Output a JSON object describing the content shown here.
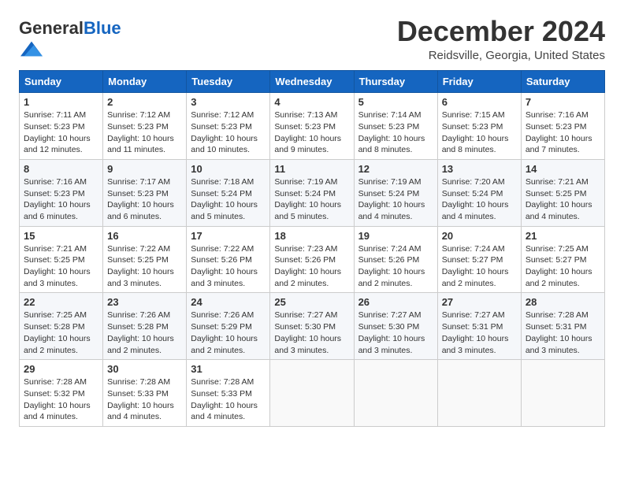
{
  "header": {
    "logo_general": "General",
    "logo_blue": "Blue",
    "month_title": "December 2024",
    "location": "Reidsville, Georgia, United States"
  },
  "weekdays": [
    "Sunday",
    "Monday",
    "Tuesday",
    "Wednesday",
    "Thursday",
    "Friday",
    "Saturday"
  ],
  "weeks": [
    [
      {
        "day": "1",
        "lines": [
          "Sunrise: 7:11 AM",
          "Sunset: 5:23 PM",
          "Daylight: 10 hours",
          "and 12 minutes."
        ]
      },
      {
        "day": "2",
        "lines": [
          "Sunrise: 7:12 AM",
          "Sunset: 5:23 PM",
          "Daylight: 10 hours",
          "and 11 minutes."
        ]
      },
      {
        "day": "3",
        "lines": [
          "Sunrise: 7:12 AM",
          "Sunset: 5:23 PM",
          "Daylight: 10 hours",
          "and 10 minutes."
        ]
      },
      {
        "day": "4",
        "lines": [
          "Sunrise: 7:13 AM",
          "Sunset: 5:23 PM",
          "Daylight: 10 hours",
          "and 9 minutes."
        ]
      },
      {
        "day": "5",
        "lines": [
          "Sunrise: 7:14 AM",
          "Sunset: 5:23 PM",
          "Daylight: 10 hours",
          "and 8 minutes."
        ]
      },
      {
        "day": "6",
        "lines": [
          "Sunrise: 7:15 AM",
          "Sunset: 5:23 PM",
          "Daylight: 10 hours",
          "and 8 minutes."
        ]
      },
      {
        "day": "7",
        "lines": [
          "Sunrise: 7:16 AM",
          "Sunset: 5:23 PM",
          "Daylight: 10 hours",
          "and 7 minutes."
        ]
      }
    ],
    [
      {
        "day": "8",
        "lines": [
          "Sunrise: 7:16 AM",
          "Sunset: 5:23 PM",
          "Daylight: 10 hours",
          "and 6 minutes."
        ]
      },
      {
        "day": "9",
        "lines": [
          "Sunrise: 7:17 AM",
          "Sunset: 5:23 PM",
          "Daylight: 10 hours",
          "and 6 minutes."
        ]
      },
      {
        "day": "10",
        "lines": [
          "Sunrise: 7:18 AM",
          "Sunset: 5:24 PM",
          "Daylight: 10 hours",
          "and 5 minutes."
        ]
      },
      {
        "day": "11",
        "lines": [
          "Sunrise: 7:19 AM",
          "Sunset: 5:24 PM",
          "Daylight: 10 hours",
          "and 5 minutes."
        ]
      },
      {
        "day": "12",
        "lines": [
          "Sunrise: 7:19 AM",
          "Sunset: 5:24 PM",
          "Daylight: 10 hours",
          "and 4 minutes."
        ]
      },
      {
        "day": "13",
        "lines": [
          "Sunrise: 7:20 AM",
          "Sunset: 5:24 PM",
          "Daylight: 10 hours",
          "and 4 minutes."
        ]
      },
      {
        "day": "14",
        "lines": [
          "Sunrise: 7:21 AM",
          "Sunset: 5:25 PM",
          "Daylight: 10 hours",
          "and 4 minutes."
        ]
      }
    ],
    [
      {
        "day": "15",
        "lines": [
          "Sunrise: 7:21 AM",
          "Sunset: 5:25 PM",
          "Daylight: 10 hours",
          "and 3 minutes."
        ]
      },
      {
        "day": "16",
        "lines": [
          "Sunrise: 7:22 AM",
          "Sunset: 5:25 PM",
          "Daylight: 10 hours",
          "and 3 minutes."
        ]
      },
      {
        "day": "17",
        "lines": [
          "Sunrise: 7:22 AM",
          "Sunset: 5:26 PM",
          "Daylight: 10 hours",
          "and 3 minutes."
        ]
      },
      {
        "day": "18",
        "lines": [
          "Sunrise: 7:23 AM",
          "Sunset: 5:26 PM",
          "Daylight: 10 hours",
          "and 2 minutes."
        ]
      },
      {
        "day": "19",
        "lines": [
          "Sunrise: 7:24 AM",
          "Sunset: 5:26 PM",
          "Daylight: 10 hours",
          "and 2 minutes."
        ]
      },
      {
        "day": "20",
        "lines": [
          "Sunrise: 7:24 AM",
          "Sunset: 5:27 PM",
          "Daylight: 10 hours",
          "and 2 minutes."
        ]
      },
      {
        "day": "21",
        "lines": [
          "Sunrise: 7:25 AM",
          "Sunset: 5:27 PM",
          "Daylight: 10 hours",
          "and 2 minutes."
        ]
      }
    ],
    [
      {
        "day": "22",
        "lines": [
          "Sunrise: 7:25 AM",
          "Sunset: 5:28 PM",
          "Daylight: 10 hours",
          "and 2 minutes."
        ]
      },
      {
        "day": "23",
        "lines": [
          "Sunrise: 7:26 AM",
          "Sunset: 5:28 PM",
          "Daylight: 10 hours",
          "and 2 minutes."
        ]
      },
      {
        "day": "24",
        "lines": [
          "Sunrise: 7:26 AM",
          "Sunset: 5:29 PM",
          "Daylight: 10 hours",
          "and 2 minutes."
        ]
      },
      {
        "day": "25",
        "lines": [
          "Sunrise: 7:27 AM",
          "Sunset: 5:30 PM",
          "Daylight: 10 hours",
          "and 3 minutes."
        ]
      },
      {
        "day": "26",
        "lines": [
          "Sunrise: 7:27 AM",
          "Sunset: 5:30 PM",
          "Daylight: 10 hours",
          "and 3 minutes."
        ]
      },
      {
        "day": "27",
        "lines": [
          "Sunrise: 7:27 AM",
          "Sunset: 5:31 PM",
          "Daylight: 10 hours",
          "and 3 minutes."
        ]
      },
      {
        "day": "28",
        "lines": [
          "Sunrise: 7:28 AM",
          "Sunset: 5:31 PM",
          "Daylight: 10 hours",
          "and 3 minutes."
        ]
      }
    ],
    [
      {
        "day": "29",
        "lines": [
          "Sunrise: 7:28 AM",
          "Sunset: 5:32 PM",
          "Daylight: 10 hours",
          "and 4 minutes."
        ]
      },
      {
        "day": "30",
        "lines": [
          "Sunrise: 7:28 AM",
          "Sunset: 5:33 PM",
          "Daylight: 10 hours",
          "and 4 minutes."
        ]
      },
      {
        "day": "31",
        "lines": [
          "Sunrise: 7:28 AM",
          "Sunset: 5:33 PM",
          "Daylight: 10 hours",
          "and 4 minutes."
        ]
      },
      {
        "day": "",
        "lines": []
      },
      {
        "day": "",
        "lines": []
      },
      {
        "day": "",
        "lines": []
      },
      {
        "day": "",
        "lines": []
      }
    ]
  ]
}
